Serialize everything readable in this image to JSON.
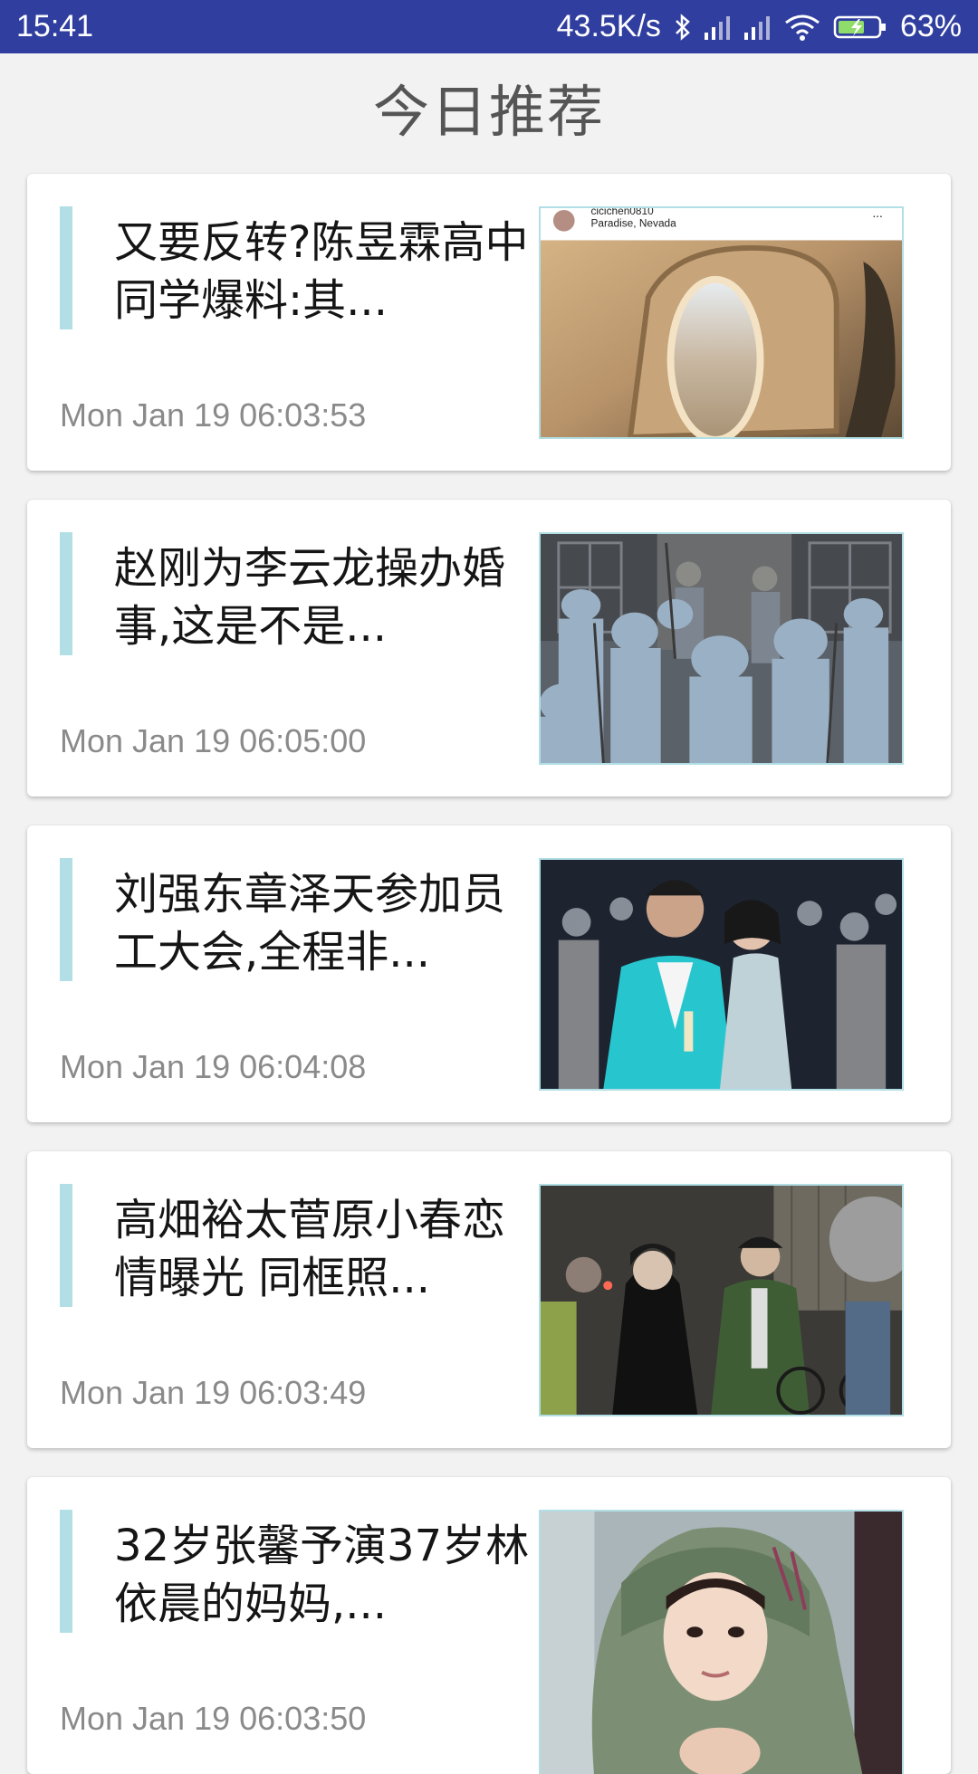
{
  "status_bar": {
    "time": "15:41",
    "speed": "43.5K/s",
    "battery": "63%"
  },
  "header": {
    "title": "今日推荐"
  },
  "articles": [
    {
      "title": "又要反转?陈昱霖高中同学爆料:其...",
      "time": "Mon Jan 19 06:03:53",
      "thumb_text_1": "cicichen0810",
      "thumb_text_2": "Paradise, Nevada",
      "thumb_text_3": "..."
    },
    {
      "title": "赵刚为李云龙操办婚事,这是不是...",
      "time": "Mon Jan 19 06:05:00"
    },
    {
      "title": "刘强东章泽天参加员工大会,全程非...",
      "time": "Mon Jan 19 06:04:08"
    },
    {
      "title": "高畑裕太菅原小春恋情曝光 同框照...",
      "time": "Mon Jan 19 06:03:49"
    },
    {
      "title": "32岁张馨予演37岁林依晨的妈妈,...",
      "time": "Mon Jan 19 06:03:50"
    }
  ],
  "colors": {
    "status_bar": "#303f9f",
    "accent_bar": "#b2dfe5",
    "background": "#f2f2f2"
  }
}
